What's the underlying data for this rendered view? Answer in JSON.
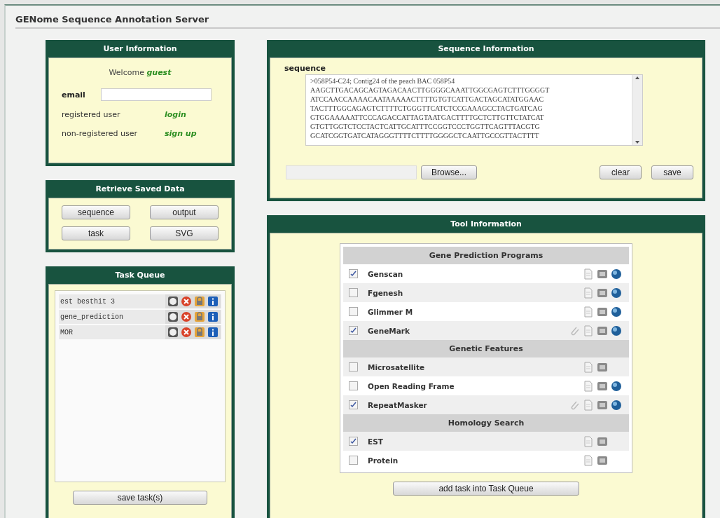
{
  "window": {
    "title": "GENome Sequence Annotation Server"
  },
  "user_info": {
    "title": "User Information",
    "welcome": "Welcome",
    "user": "guest",
    "email_label": "email",
    "rows": [
      {
        "label": "registered user",
        "link": "login"
      },
      {
        "label": "non-registered user",
        "link": "sign up"
      }
    ]
  },
  "retrieve": {
    "title": "Retrieve Saved Data",
    "buttons": [
      "sequence",
      "output",
      "task",
      "SVG"
    ]
  },
  "task_queue": {
    "title": "Task Queue",
    "tasks": [
      {
        "name": "est besthit 3"
      },
      {
        "name": "gene_prediction"
      },
      {
        "name": "MOR"
      }
    ],
    "save_button": "save task(s)"
  },
  "sequence_info": {
    "title": "Sequence Information",
    "label": "sequence",
    "lines": [
      ">058P54-C24; Contig24 of the peach BAC 058P54",
      "AAGCTTGACAGCAGTAGACAACTTGGGGCAAATTGGCGAGTCTTTGGGGT",
      "ATCCAACCAAAACAATAAAAACTTTTGTGTCATTGACTAGCATATGGAAC",
      "TACTTTGGCAGAGTCTTTTCTGGGTTCATCTCCGAAAGCCTACTGATCAG",
      "GTGGAAAAATTCCCAGACCATTAGTAATGACTTTTGCTCTTGTTCTATCAT",
      "GTGTTGGTCTCCTACTCATTGCATTTCCGGTCCCTGGTTCAGTTTACGTG",
      "GCATCGGTGATCATAGGGTTTTCTTTTGGGGCTCAATTGCCGTTACTTTT"
    ],
    "browse": "Browse...",
    "clear": "clear",
    "save": "save"
  },
  "tool_info": {
    "title": "Tool Information",
    "rows": [
      {
        "kind": "section",
        "label": "Gene Prediction Programs"
      },
      {
        "kind": "program",
        "label": "Genscan",
        "checked": true,
        "paperclip": false,
        "globe": true
      },
      {
        "kind": "program",
        "label": "Fgenesh",
        "checked": false,
        "paperclip": false,
        "globe": true
      },
      {
        "kind": "program",
        "label": "Glimmer M",
        "checked": false,
        "paperclip": false,
        "globe": true
      },
      {
        "kind": "program",
        "label": "GeneMark",
        "checked": true,
        "paperclip": true,
        "globe": true
      },
      {
        "kind": "section",
        "label": "Genetic Features"
      },
      {
        "kind": "program",
        "label": "Microsatellite",
        "checked": false,
        "paperclip": false,
        "globe": false
      },
      {
        "kind": "program",
        "label": "Open Reading Frame",
        "checked": false,
        "paperclip": false,
        "globe": true
      },
      {
        "kind": "program",
        "label": "RepeatMasker",
        "checked": true,
        "paperclip": true,
        "globe": true
      },
      {
        "kind": "section",
        "label": "Homology Search"
      },
      {
        "kind": "program",
        "label": "EST",
        "checked": true,
        "paperclip": false,
        "globe": false
      },
      {
        "kind": "program",
        "label": "Protein",
        "checked": false,
        "paperclip": false,
        "globe": false
      }
    ],
    "add_button": "add task into Task Queue"
  }
}
